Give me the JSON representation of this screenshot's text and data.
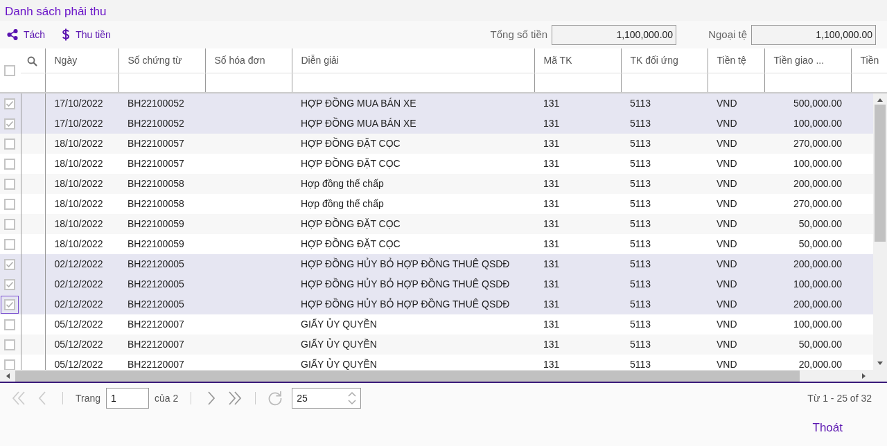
{
  "title": "Danh sách phải thu",
  "toolbar": [
    {
      "kind": "share",
      "label": "Tách"
    },
    {
      "kind": "dollar",
      "label": "Thu tiền"
    }
  ],
  "totals": [
    {
      "label": "Tổng số tiền",
      "value": "1,100,000.00"
    },
    {
      "label": "Ngoại tệ",
      "value": "1,100,000.00"
    }
  ],
  "table": {
    "select_all_checked": false,
    "columns": [
      {
        "label": "Ngày",
        "kind": "text"
      },
      {
        "label": "Số chứng từ",
        "kind": "text"
      },
      {
        "label": "Số hóa đơn",
        "kind": "text"
      },
      {
        "label": "Diễn giải",
        "kind": "text"
      },
      {
        "label": "Mã TK",
        "kind": "text"
      },
      {
        "label": "TK đối ứng",
        "kind": "text"
      },
      {
        "label": "Tiền tệ",
        "kind": "text"
      },
      {
        "label": "Tiền giao ...",
        "kind": "amount"
      },
      {
        "label": "Tiền",
        "kind": "text"
      }
    ],
    "rows": [
      {
        "checked": true,
        "focused": false,
        "cells": [
          "17/10/2022",
          "BH22100052",
          "",
          "HỢP ĐỒNG MUA BÁN XE",
          "131",
          "5113",
          "VND",
          "500,000.00",
          ""
        ]
      },
      {
        "checked": true,
        "focused": false,
        "cells": [
          "17/10/2022",
          "BH22100052",
          "",
          "HỢP ĐỒNG MUA BÁN XE",
          "131",
          "5113",
          "VND",
          "100,000.00",
          ""
        ]
      },
      {
        "checked": false,
        "focused": false,
        "cells": [
          "18/10/2022",
          "BH22100057",
          "",
          "HỢP ĐỒNG ĐẶT CỌC",
          "131",
          "5113",
          "VND",
          "270,000.00",
          ""
        ]
      },
      {
        "checked": false,
        "focused": false,
        "cells": [
          "18/10/2022",
          "BH22100057",
          "",
          "HỢP ĐỒNG ĐẶT CỌC",
          "131",
          "5113",
          "VND",
          "100,000.00",
          ""
        ]
      },
      {
        "checked": false,
        "focused": false,
        "cells": [
          "18/10/2022",
          "BH22100058",
          "",
          "Hợp đồng thế chấp",
          "131",
          "5113",
          "VND",
          "200,000.00",
          ""
        ]
      },
      {
        "checked": false,
        "focused": false,
        "cells": [
          "18/10/2022",
          "BH22100058",
          "",
          "Hợp đồng thế chấp",
          "131",
          "5113",
          "VND",
          "270,000.00",
          ""
        ]
      },
      {
        "checked": false,
        "focused": false,
        "cells": [
          "18/10/2022",
          "BH22100059",
          "",
          "HỢP ĐỒNG ĐẶT CỌC",
          "131",
          "5113",
          "VND",
          "50,000.00",
          ""
        ]
      },
      {
        "checked": false,
        "focused": false,
        "cells": [
          "18/10/2022",
          "BH22100059",
          "",
          "HỢP ĐỒNG ĐẶT CỌC",
          "131",
          "5113",
          "VND",
          "50,000.00",
          ""
        ]
      },
      {
        "checked": true,
        "focused": false,
        "cells": [
          "02/12/2022",
          "BH22120005",
          "",
          "HỢP ĐỒNG HỦY BỎ HỢP ĐỒNG THUÊ QSDĐ",
          "131",
          "5113",
          "VND",
          "200,000.00",
          ""
        ]
      },
      {
        "checked": true,
        "focused": false,
        "cells": [
          "02/12/2022",
          "BH22120005",
          "",
          "HỢP ĐỒNG HỦY BỎ HỢP ĐỒNG THUÊ QSDĐ",
          "131",
          "5113",
          "VND",
          "100,000.00",
          ""
        ]
      },
      {
        "checked": true,
        "focused": true,
        "cells": [
          "02/12/2022",
          "BH22120005",
          "",
          "HỢP ĐỒNG HỦY BỎ HỢP ĐỒNG THUÊ QSDĐ",
          "131",
          "5113",
          "VND",
          "200,000.00",
          ""
        ]
      },
      {
        "checked": false,
        "focused": false,
        "cells": [
          "05/12/2022",
          "BH22120007",
          "",
          "GIẤY ỦY QUYỀN",
          "131",
          "5113",
          "VND",
          "100,000.00",
          ""
        ]
      },
      {
        "checked": false,
        "focused": false,
        "cells": [
          "05/12/2022",
          "BH22120007",
          "",
          "GIẤY ỦY QUYỀN",
          "131",
          "5113",
          "VND",
          "50,000.00",
          ""
        ]
      },
      {
        "checked": false,
        "focused": false,
        "cells": [
          "05/12/2022",
          "BH22120007",
          "",
          "GIẤY ỦY QUYỀN",
          "131",
          "5113",
          "VND",
          "20,000.00",
          ""
        ]
      }
    ]
  },
  "pager": {
    "nav": [
      {
        "kind": "first",
        "disabled": true
      },
      {
        "kind": "prev",
        "disabled": true
      },
      {
        "kind": "next",
        "disabled": false
      },
      {
        "kind": "last",
        "disabled": false
      }
    ],
    "page_label": "Trang",
    "page": "1",
    "page_count": "của 2",
    "page_size": "25",
    "range": "Từ 1 - 25 of 32"
  },
  "exit_button": "Thoát"
}
